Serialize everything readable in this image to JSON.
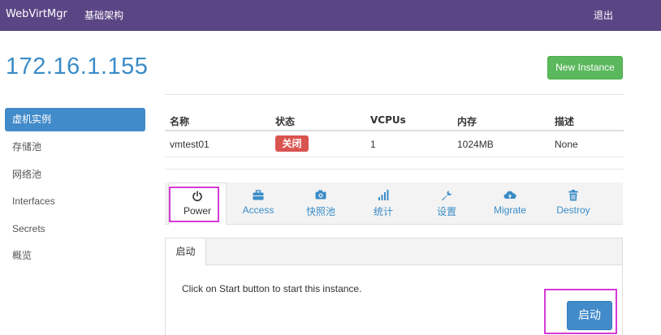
{
  "navbar": {
    "brand": "WebVirtMgr",
    "infra_link": "基础架构",
    "logout": "退出"
  },
  "host": {
    "title": "172.16.1.155"
  },
  "actions": {
    "new_instance": "New Instance"
  },
  "sidebar": {
    "items": [
      {
        "label": "虚机实例",
        "active": true
      },
      {
        "label": "存储池",
        "active": false
      },
      {
        "label": "网络池",
        "active": false
      },
      {
        "label": "Interfaces",
        "active": false
      },
      {
        "label": "Secrets",
        "active": false
      },
      {
        "label": "概览",
        "active": false
      }
    ]
  },
  "table": {
    "headers": [
      "名称",
      "状态",
      "VCPUs",
      "内存",
      "描述"
    ],
    "rows": [
      {
        "name": "vmtest01",
        "status": "关闭",
        "vcpus": "1",
        "memory": "1024MB",
        "description": "None"
      }
    ]
  },
  "tabs": [
    {
      "label": "Power",
      "icon": "power-icon"
    },
    {
      "label": "Access",
      "icon": "briefcase-icon"
    },
    {
      "label": "快照池",
      "icon": "camera-icon"
    },
    {
      "label": "统计",
      "icon": "stats-icon"
    },
    {
      "label": "设置",
      "icon": "wrench-icon"
    },
    {
      "label": "Migrate",
      "icon": "cloud-upload-icon"
    },
    {
      "label": "Destroy",
      "icon": "trash-icon"
    }
  ],
  "power": {
    "subtab": "启动",
    "hint": "Click on Start button to start this instance.",
    "start_button": "启动"
  }
}
